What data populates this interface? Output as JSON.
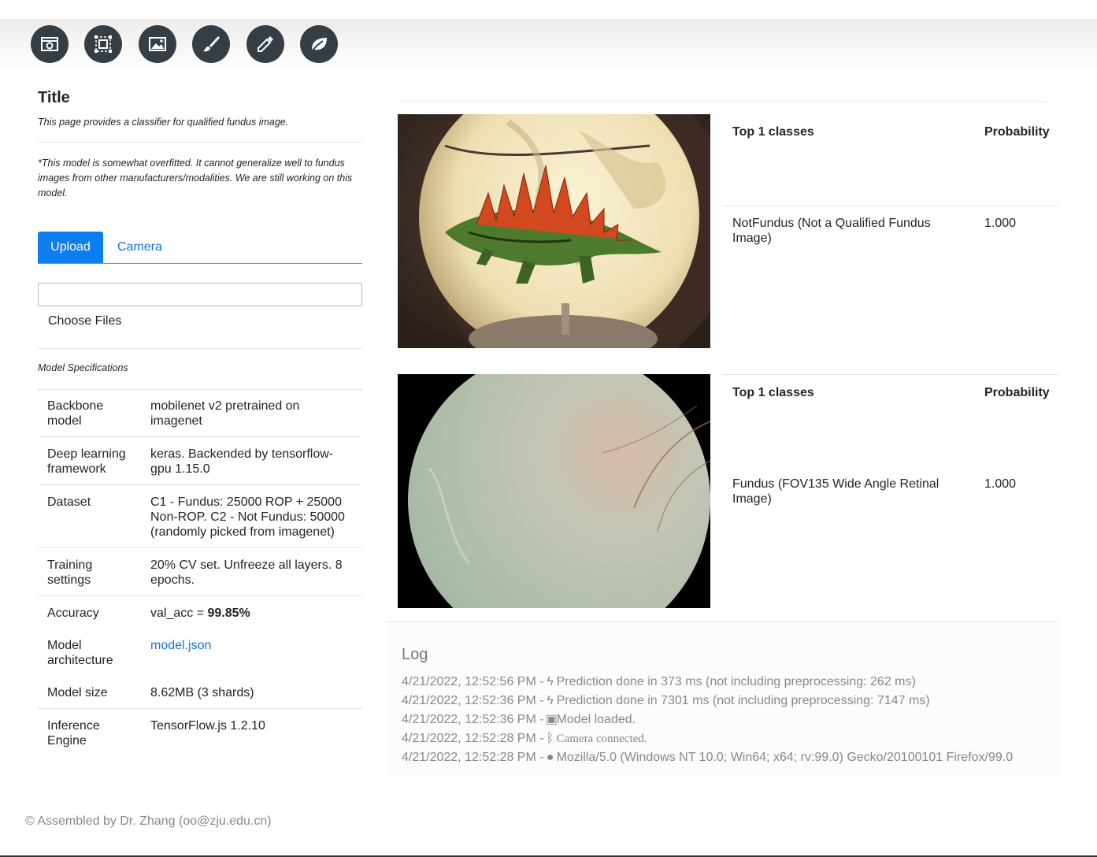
{
  "toolbar": {
    "tools": [
      "camera-icon",
      "crop-icon",
      "image-icon",
      "brush-icon",
      "eyedropper-icon",
      "leaf-icon"
    ]
  },
  "left": {
    "title": "Title",
    "description": "This page provides a classifier for qualified fundus image.",
    "note": "*This model is somewhat overfitted. It cannot generalize well to fundus images from other manufacturers/modalities. We are still working on this model.",
    "tabs": {
      "upload": "Upload",
      "camera": "Camera"
    },
    "choose_files": "Choose Files",
    "spec_caption": "Model Specifications",
    "specs": [
      {
        "key": "Backbone model",
        "value": "mobilenet v2 pretrained on imagenet"
      },
      {
        "key": "Deep learning framework",
        "value": "keras. Backended by tensorflow-gpu 1.15.0"
      },
      {
        "key": "Dataset",
        "value": "C1 - Fundus: 25000 ROP + 25000 Non-ROP. C2 - Not Fundus: 50000 (randomly picked from imagenet)"
      },
      {
        "key": "Training settings",
        "value": "20% CV set. Unfreeze all layers. 8 epochs."
      },
      {
        "key": "Accuracy",
        "value_prefix": "val_acc = ",
        "value_bold": "99.85%"
      },
      {
        "key": "Model architecture",
        "link": "model.json"
      },
      {
        "key": "Model size",
        "value": "8.62MB (3 shards)"
      },
      {
        "key": "Inference Engine",
        "value": "TensorFlow.js 1.2.10"
      }
    ]
  },
  "results": [
    {
      "col1": "Top 1 classes",
      "col2": "Probability",
      "class": "NotFundus (Not a Qualified Fundus Image)",
      "prob": "1.000"
    },
    {
      "col1": "Top 1 classes",
      "col2": "Probability",
      "class": "Fundus (FOV135 Wide Angle Retinal Image)",
      "prob": "1.000"
    }
  ],
  "log": {
    "title": "Log",
    "lines": [
      {
        "time": "4/21/2022, 12:52:56 PM -",
        "icon": "bolt-icon",
        "text": "Prediction done in 373 ms (not including preprocessing: 262 ms)"
      },
      {
        "time": "4/21/2022, 12:52:36 PM -",
        "icon": "bolt-icon",
        "text": "Prediction done in 7301 ms (not including preprocessing: 7147 ms)"
      },
      {
        "time": "4/21/2022, 12:52:36 PM -",
        "icon": "cube-icon",
        "text": "Model loaded."
      },
      {
        "time": "4/21/2022, 12:52:28 PM -",
        "icon": "bluetooth-icon",
        "text": "Camera connected."
      },
      {
        "time": "4/21/2022, 12:52:28 PM -",
        "icon": "globe-icon",
        "text": "Mozilla/5.0 (Windows NT 10.0; Win64; x64; rv:99.0) Gecko/20100101 Firefox/99.0"
      }
    ]
  },
  "footer": "© Assembled by Dr. Zhang (oo@zju.edu.cn)"
}
